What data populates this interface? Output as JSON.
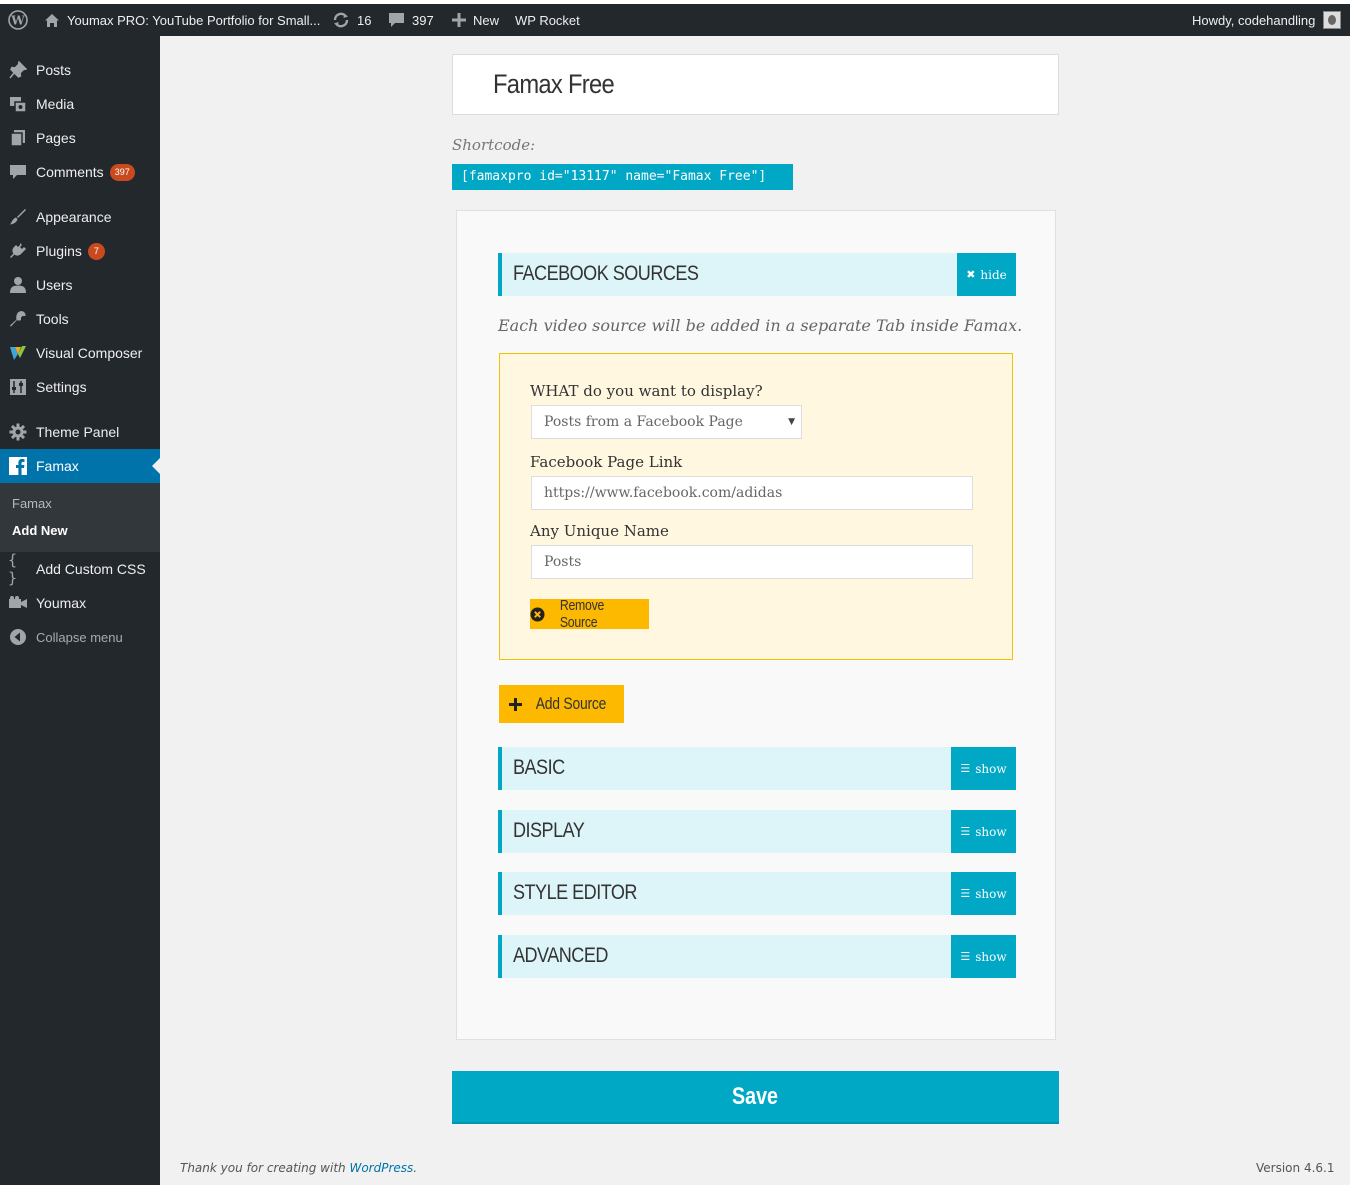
{
  "adminbar": {
    "site_name": "Youmax PRO: YouTube Portfolio for Small...",
    "updates_count": "16",
    "comments_count": "397",
    "new_label": "New",
    "rocket_label": "WP Rocket",
    "greeting": "Howdy, codehandling"
  },
  "sidebar": {
    "items": [
      {
        "label": "Posts",
        "icon": "pin-icon"
      },
      {
        "label": "Media",
        "icon": "media-icon"
      },
      {
        "label": "Pages",
        "icon": "pages-icon"
      },
      {
        "label": "Comments",
        "icon": "comment-icon",
        "badge": "397"
      },
      {
        "label": "Appearance",
        "icon": "brush-icon"
      },
      {
        "label": "Plugins",
        "icon": "plugin-icon",
        "badge": "7"
      },
      {
        "label": "Users",
        "icon": "user-icon"
      },
      {
        "label": "Tools",
        "icon": "wrench-icon"
      },
      {
        "label": "Visual Composer",
        "icon": "vc-icon"
      },
      {
        "label": "Settings",
        "icon": "settings-icon"
      },
      {
        "label": "Theme Panel",
        "icon": "gear-icon"
      },
      {
        "label": "Famax",
        "icon": "facebook-icon"
      },
      {
        "label": "Add Custom CSS",
        "icon": "braces-icon"
      },
      {
        "label": "Youmax",
        "icon": "video-icon"
      }
    ],
    "submenu": [
      "Famax",
      "Add New"
    ],
    "collapse_label": "Collapse menu"
  },
  "main": {
    "title": "Famax Free",
    "shortcode_label": "Shortcode:",
    "shortcode": "[famaxpro id=\"13117\" name=\"Famax Free\"]",
    "facebook_section": {
      "title": "FACEBOOK SOURCES",
      "button": "hide"
    },
    "description": "Each video source will be added in a separate Tab inside Famax.",
    "source": {
      "what_label": "WHAT do you want to display?",
      "what_value": "Posts from a Facebook Page",
      "link_label": "Facebook Page Link",
      "link_value": "https://www.facebook.com/adidas",
      "name_label": "Any Unique Name",
      "name_value": "Posts",
      "remove_button": "Remove Source"
    },
    "add_source_button": "Add Source",
    "sections": [
      {
        "title": "BASIC",
        "button": "show"
      },
      {
        "title": "DISPLAY",
        "button": "show"
      },
      {
        "title": "STYLE EDITOR",
        "button": "show"
      },
      {
        "title": "ADVANCED",
        "button": "show"
      }
    ],
    "save_button": "Save"
  },
  "footer": {
    "thanks_prefix": "Thank you for creating with ",
    "thanks_link": "WordPress",
    "thanks_suffix": ".",
    "version": "Version 4.6.1"
  }
}
